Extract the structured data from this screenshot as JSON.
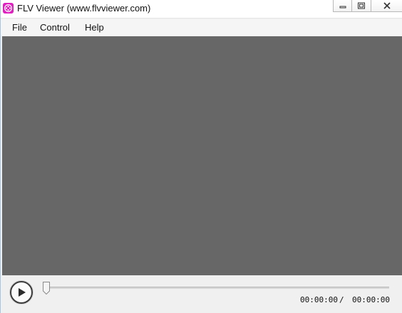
{
  "window": {
    "title": "FLV Viewer (www.flvviewer.com)",
    "icon": "flv-viewer-app-icon"
  },
  "caption_buttons": {
    "minimize_icon": "minimize-icon",
    "maximize_icon": "maximize-icon",
    "close_icon": "close-icon"
  },
  "menu": {
    "items": [
      {
        "label": "File"
      },
      {
        "label": "Control"
      },
      {
        "label": "Help"
      }
    ]
  },
  "video": {
    "background_color": "#676767"
  },
  "controls": {
    "play_icon": "play-icon",
    "seek_position": 0,
    "current_time": "00:00:00",
    "separator": "/",
    "total_time": "00:00:00"
  },
  "colors": {
    "app_icon": "#e11ec0",
    "window_border": "#a9c4de"
  }
}
